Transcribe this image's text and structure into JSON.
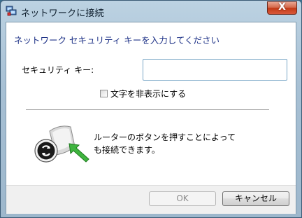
{
  "window": {
    "title": "ネットワークに接続",
    "close_symbol": "X"
  },
  "dialog": {
    "heading": "ネットワーク セキュリティ キーを入力してください",
    "security_key_label": "セキュリティ キー:",
    "security_key_value": "",
    "hide_characters_label": "文字を非表示にする",
    "hide_characters_checked": false,
    "wps_text_line1": "ルーターのボタンを押すことによって",
    "wps_text_line2": "も接続できます。"
  },
  "buttons": {
    "ok_label": "OK",
    "ok_enabled": false,
    "cancel_label": "キャンセル"
  },
  "icons": {
    "title_icon": "network-icon",
    "wps_icon": "router-wps-icon",
    "close_icon": "close-icon"
  }
}
